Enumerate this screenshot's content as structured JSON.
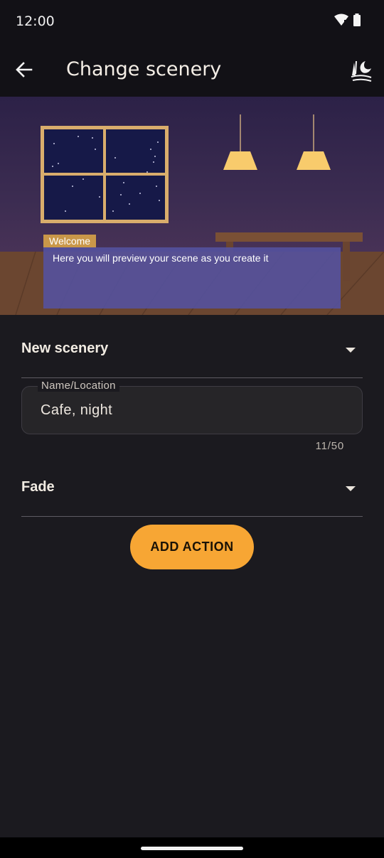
{
  "status_bar": {
    "time": "12:00"
  },
  "app_bar": {
    "title": "Change scenery"
  },
  "preview": {
    "speaker": "Welcome",
    "text": "Here you will preview your scene as you create it"
  },
  "scenery_dropdown": {
    "selected": "New scenery"
  },
  "name_field": {
    "label": "Name/Location",
    "value": "Cafe, night",
    "counter": "11/50"
  },
  "transition_dropdown": {
    "selected": "Fade"
  },
  "actions": {
    "add_action_label": "ADD ACTION"
  },
  "colors": {
    "background": "#1b1a1f",
    "app_bar": "#121116",
    "accent": "#f7a634",
    "dialog": "#5452a0",
    "speaker_tag": "#c99749"
  }
}
